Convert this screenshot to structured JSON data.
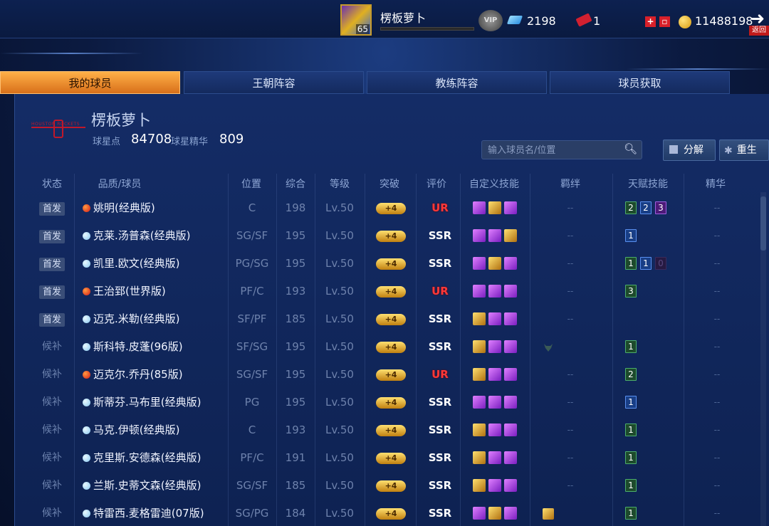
{
  "player": {
    "name": "楞板萝卜",
    "level": "65",
    "vip_label": "VIP",
    "diamonds": "2198",
    "tickets": "1",
    "coins": "11488198",
    "back_label": "返回"
  },
  "tabs": [
    "我的球员",
    "王朝阵容",
    "教练阵容",
    "球员获取"
  ],
  "team": {
    "name": "楞板萝卜",
    "logo_text": "HOUSTON ROCKETS",
    "star_points_label": "球星点",
    "star_points": "84708",
    "essence_label": "球星精华",
    "essence": "809"
  },
  "search": {
    "placeholder": "输入球员名/位置"
  },
  "actions": {
    "decompose": "分解",
    "reborn": "重生"
  },
  "columns": [
    "状态",
    "品质/球员",
    "位置",
    "综合",
    "等级",
    "突破",
    "评价",
    "自定义技能",
    "羁绊",
    "天赋技能",
    "精华"
  ],
  "rows": [
    {
      "status": "首发",
      "starter": true,
      "quality": "red",
      "name": "姚明(经典版)",
      "pos": "C",
      "ovr": "198",
      "lv": "Lv.50",
      "brk": "+4",
      "rating": "UR",
      "skills": [
        "purple",
        "gold",
        "purple"
      ],
      "bond": "--",
      "talents": [
        {
          "v": "2",
          "c": "green"
        },
        {
          "v": "2",
          "c": "blue"
        },
        {
          "v": "3",
          "c": "purple"
        }
      ],
      "essence": "--"
    },
    {
      "status": "首发",
      "starter": true,
      "quality": "blue",
      "name": "克莱.汤普森(经典版)",
      "pos": "SG/SF",
      "ovr": "195",
      "lv": "Lv.50",
      "brk": "+4",
      "rating": "SSR",
      "skills": [
        "purple",
        "purple",
        "gold"
      ],
      "bond": "--",
      "talents": [
        {
          "v": "1",
          "c": "blue"
        }
      ],
      "essence": "--"
    },
    {
      "status": "首发",
      "starter": true,
      "quality": "blue",
      "name": "凯里.欧文(经典版)",
      "pos": "PG/SG",
      "ovr": "195",
      "lv": "Lv.50",
      "brk": "+4",
      "rating": "SSR",
      "skills": [
        "purple",
        "gold",
        "purple"
      ],
      "bond": "--",
      "talents": [
        {
          "v": "1",
          "c": "green"
        },
        {
          "v": "1",
          "c": "blue"
        },
        {
          "v": "0",
          "c": "dim"
        }
      ],
      "essence": "--"
    },
    {
      "status": "首发",
      "starter": true,
      "quality": "red",
      "name": "王治郅(世界版)",
      "pos": "PF/C",
      "ovr": "193",
      "lv": "Lv.50",
      "brk": "+4",
      "rating": "UR",
      "skills": [
        "purple",
        "purple",
        "purple"
      ],
      "bond": "--",
      "talents": [
        {
          "v": "3",
          "c": "green"
        }
      ],
      "essence": "--"
    },
    {
      "status": "首发",
      "starter": true,
      "quality": "blue",
      "name": "迈克.米勒(经典版)",
      "pos": "SF/PF",
      "ovr": "185",
      "lv": "Lv.50",
      "brk": "+4",
      "rating": "SSR",
      "skills": [
        "gold",
        "purple",
        "purple"
      ],
      "bond": "--",
      "talents": [],
      "essence": "--"
    },
    {
      "status": "候补",
      "starter": false,
      "quality": "blue",
      "name": "斯科特.皮蓬(96版)",
      "pos": "SF/SG",
      "ovr": "195",
      "lv": "Lv.50",
      "brk": "+4",
      "rating": "SSR",
      "skills": [
        "gold",
        "purple",
        "purple"
      ],
      "bond": "",
      "bond_icon": "bull-icon",
      "talents": [
        {
          "v": "1",
          "c": "green"
        }
      ],
      "essence": "--"
    },
    {
      "status": "候补",
      "starter": false,
      "quality": "red",
      "name": "迈克尔.乔丹(85版)",
      "pos": "SG/SF",
      "ovr": "195",
      "lv": "Lv.50",
      "brk": "+4",
      "rating": "UR",
      "skills": [
        "gold",
        "purple",
        "purple"
      ],
      "bond": "--",
      "talents": [
        {
          "v": "2",
          "c": "green"
        }
      ],
      "essence": "--"
    },
    {
      "status": "候补",
      "starter": false,
      "quality": "blue",
      "name": "斯蒂芬.马布里(经典版)",
      "pos": "PG",
      "ovr": "195",
      "lv": "Lv.50",
      "brk": "+4",
      "rating": "SSR",
      "skills": [
        "purple",
        "purple",
        "purple"
      ],
      "bond": "--",
      "talents": [
        {
          "v": "1",
          "c": "blue"
        }
      ],
      "essence": "--"
    },
    {
      "status": "候补",
      "starter": false,
      "quality": "blue",
      "name": "马克.伊顿(经典版)",
      "pos": "C",
      "ovr": "193",
      "lv": "Lv.50",
      "brk": "+4",
      "rating": "SSR",
      "skills": [
        "gold",
        "purple",
        "purple"
      ],
      "bond": "--",
      "talents": [
        {
          "v": "1",
          "c": "green"
        }
      ],
      "essence": "--"
    },
    {
      "status": "候补",
      "starter": false,
      "quality": "blue",
      "name": "克里斯.安德森(经典版)",
      "pos": "PF/C",
      "ovr": "191",
      "lv": "Lv.50",
      "brk": "+4",
      "rating": "SSR",
      "skills": [
        "gold",
        "purple",
        "purple"
      ],
      "bond": "--",
      "talents": [
        {
          "v": "1",
          "c": "green"
        }
      ],
      "essence": "--"
    },
    {
      "status": "候补",
      "starter": false,
      "quality": "blue",
      "name": "兰斯.史蒂文森(经典版)",
      "pos": "SG/SF",
      "ovr": "185",
      "lv": "Lv.50",
      "brk": "+4",
      "rating": "SSR",
      "skills": [
        "gold",
        "purple",
        "purple"
      ],
      "bond": "--",
      "talents": [
        {
          "v": "1",
          "c": "green"
        }
      ],
      "essence": "--"
    },
    {
      "status": "候补",
      "starter": false,
      "quality": "blue",
      "name": "特雷西.麦格雷迪(07版)",
      "pos": "SG/PG",
      "ovr": "184",
      "lv": "Lv.50",
      "brk": "+4",
      "rating": "SSR",
      "skills": [
        "purple",
        "gold",
        "purple"
      ],
      "bond": "",
      "bond_icon": "gold-card-icon",
      "talents": [
        {
          "v": "1",
          "c": "green"
        }
      ],
      "essence": "--"
    }
  ]
}
